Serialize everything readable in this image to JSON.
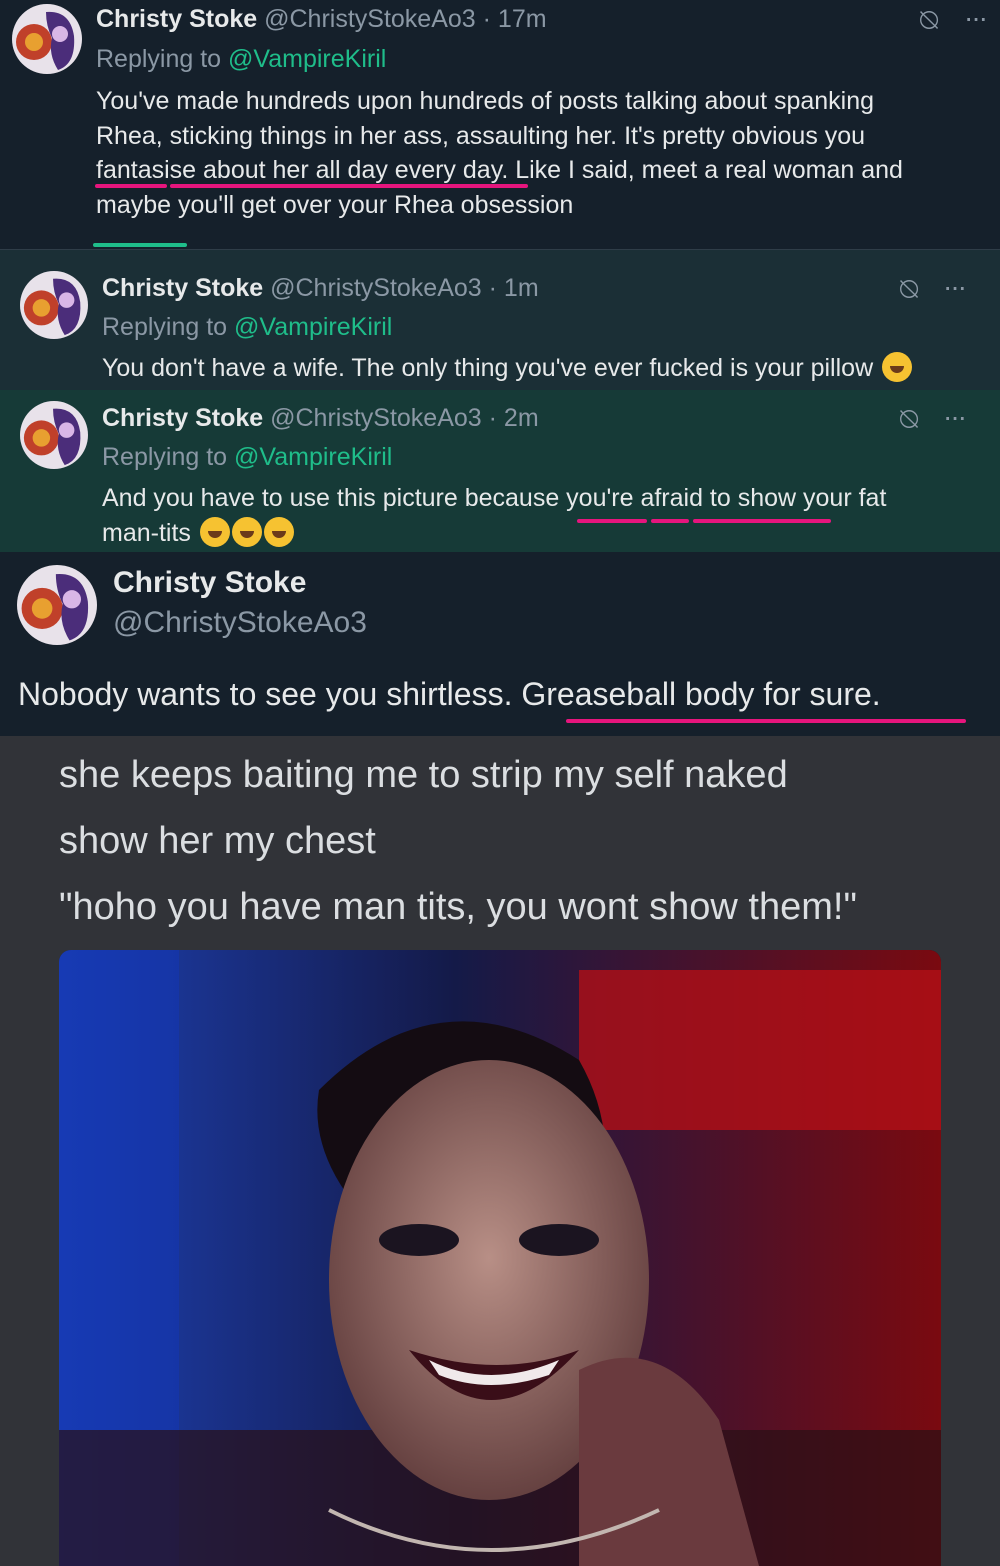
{
  "tweets": [
    {
      "name": "Christy Stoke",
      "handle": "@ChristyStokeAo3 · 17m",
      "replying_prefix": "Replying to ",
      "replying_mention": "@VampireKiril",
      "lines": [
        "You've made hundreds upon hundreds of posts talking about spanking",
        "Rhea, sticking things in her ass, assaulting her. It's pretty obvious you",
        "fantasise about her all day every day. Like I said, meet a real woman and",
        "maybe you'll get over your Rhea obsession"
      ]
    },
    {
      "name": "Christy Stoke",
      "handle": "@ChristyStokeAo3 · 1m",
      "replying_prefix": "Replying to ",
      "replying_mention": "@VampireKiril",
      "lines": [
        "You don't have a wife. The only thing you've ever fucked is your pillow"
      ],
      "emoji": "rolling-on-floor-laughing"
    },
    {
      "name": "Christy Stoke",
      "handle": "@ChristyStokeAo3 · 2m",
      "replying_prefix": "Replying to ",
      "replying_mention": "@VampireKiril",
      "lines": [
        "And you have to use this picture because you're afraid to show your fat",
        "man-tits"
      ],
      "emoji": "rolling-on-floor-laughing"
    }
  ],
  "main_tweet": {
    "name": "Christy Stoke",
    "handle": "@ChristyStokeAo3",
    "text": "Nobody wants to see you shirtless. Greaseball body for sure."
  },
  "discord": {
    "lines": [
      "she keeps baiting me to strip my self naked",
      "show her my chest",
      "\"hoho you have man tits, you wont show them!\""
    ]
  },
  "icons": {
    "grok": "grok-icon",
    "more": "more-icon",
    "emoji": "rolling-laughing-emoji-icon"
  },
  "colors": {
    "bg_dark": "#15202b",
    "mention": "#1fbd8a",
    "highlight_underline": "#e6157d",
    "discord_bg": "#313338"
  }
}
